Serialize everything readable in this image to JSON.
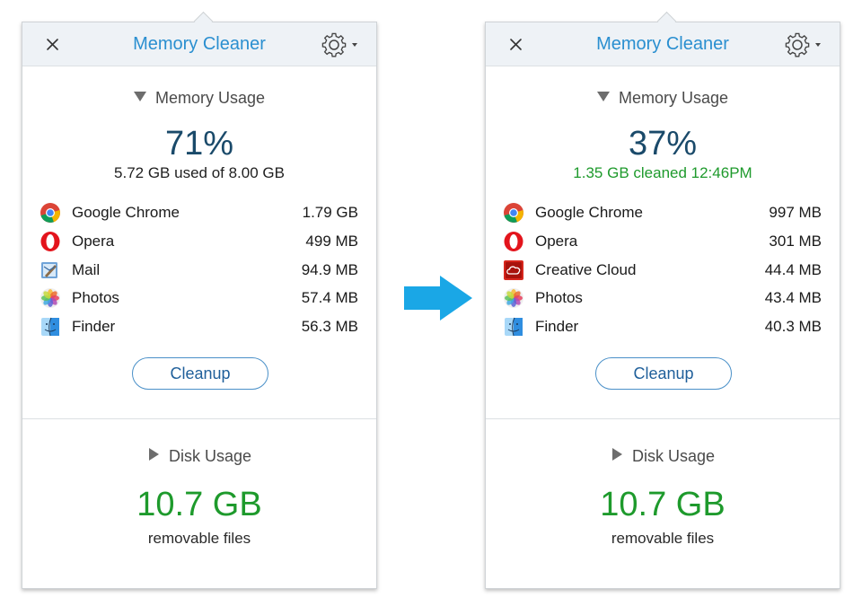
{
  "colors": {
    "accent": "#2a8fd0",
    "percent": "#1a4a6a",
    "green": "#1e9a2c",
    "arrow": "#1aa7e6"
  },
  "panels": [
    {
      "title": "Memory Cleaner",
      "memory_header": "Memory Usage",
      "percent": "71%",
      "sub_text": "5.72 GB used of 8.00 GB",
      "apps": [
        {
          "icon": "chrome-icon",
          "name": "Google Chrome",
          "size": "1.79 GB"
        },
        {
          "icon": "opera-icon",
          "name": "Opera",
          "size": "499 MB"
        },
        {
          "icon": "mail-icon",
          "name": "Mail",
          "size": "94.9 MB"
        },
        {
          "icon": "photos-icon",
          "name": "Photos",
          "size": "57.4 MB"
        },
        {
          "icon": "finder-icon",
          "name": "Finder",
          "size": "56.3 MB"
        }
      ],
      "cleanup_label": "Cleanup",
      "disk_header": "Disk Usage",
      "disk_value": "10.7 GB",
      "disk_caption": "removable files"
    },
    {
      "title": "Memory Cleaner",
      "memory_header": "Memory Usage",
      "percent": "37%",
      "sub_text": "1.35 GB cleaned 12:46PM",
      "apps": [
        {
          "icon": "chrome-icon",
          "name": "Google Chrome",
          "size": "997 MB"
        },
        {
          "icon": "opera-icon",
          "name": "Opera",
          "size": "301 MB"
        },
        {
          "icon": "creative-cloud-icon",
          "name": "Creative Cloud",
          "size": "44.4 MB"
        },
        {
          "icon": "photos-icon",
          "name": "Photos",
          "size": "43.4 MB"
        },
        {
          "icon": "finder-icon",
          "name": "Finder",
          "size": "40.3 MB"
        }
      ],
      "cleanup_label": "Cleanup",
      "disk_header": "Disk Usage",
      "disk_value": "10.7 GB",
      "disk_caption": "removable files"
    }
  ]
}
